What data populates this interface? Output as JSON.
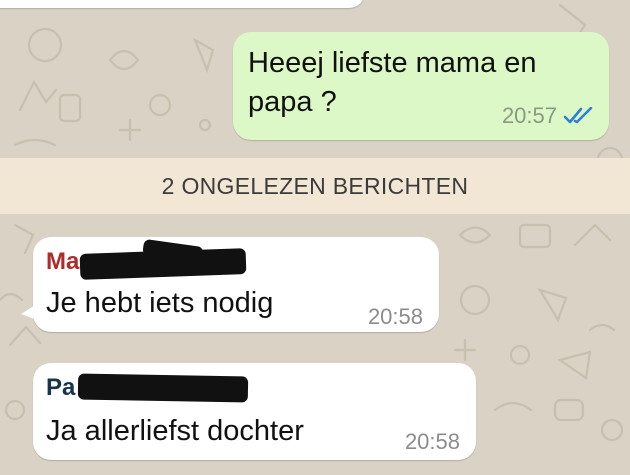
{
  "colors": {
    "wallpaper": "#d9d2c5",
    "outgoing_bubble": "#dcf8c6",
    "incoming_bubble": "#ffffff",
    "unread_banner": "#f2e6d5",
    "read_ticks": "#2f7fd6",
    "sender_1": "#b12a2a",
    "sender_2": "#16344a"
  },
  "outgoing_message": {
    "text": "Heeej liefste mama en papa ?",
    "time": "20:57",
    "status_icon": "double-check-read-icon"
  },
  "unread_banner": {
    "label": "2 ONGELEZEN BERICHTEN"
  },
  "incoming_messages": [
    {
      "sender": "Ma",
      "text": "Je hebt iets nodig",
      "time": "20:58"
    },
    {
      "sender": "Pa",
      "text": "Ja allerliefst dochter",
      "time": "20:58"
    }
  ]
}
